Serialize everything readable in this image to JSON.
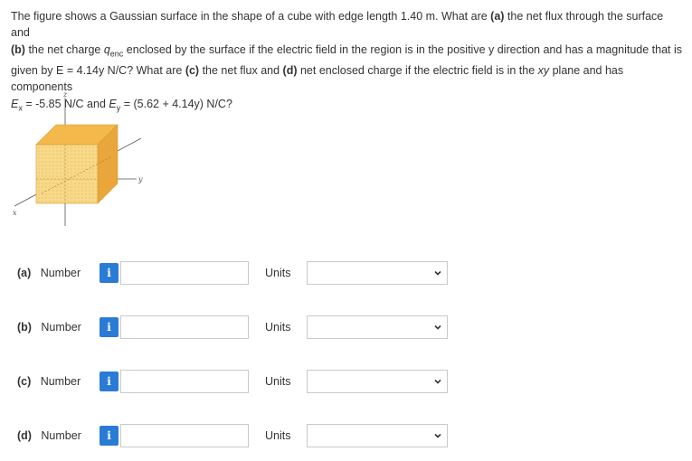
{
  "question": {
    "line1": "The figure shows a Gaussian surface in the shape of a cube with edge length 1.40 m. What are ",
    "part_a_tag": "(a)",
    "line1b": " the net flux through the surface and",
    "part_b_tag": "(b)",
    "line2a": " the net charge ",
    "q_sym": "q",
    "q_sub": "enc",
    "line2b": " enclosed by the surface if the electric field in the region is in the positive y direction and has a magnitude that is",
    "line3a": "given by E = 4.14y N/C? What are ",
    "part_c_tag": "(c)",
    "line3b": " the net flux and ",
    "part_d_tag": "(d)",
    "line3c": " net enclosed charge if the electric field is in the ",
    "xy": "xy",
    "line3d": " plane and has components",
    "ex_sym": "E",
    "ex_sub": "x",
    "ex_val": " = -5.85 N/C and ",
    "ey_sym": "E",
    "ey_sub": "y",
    "ey_val": " = (5.62 + 4.14y) N/C?"
  },
  "figure": {
    "axis_z": "z",
    "axis_y": "y",
    "axis_x": "x",
    "colors": {
      "cube_front": "#f7d77e",
      "cube_top": "#f3b94a",
      "cube_side": "#e9a63a",
      "axis": "#555555"
    }
  },
  "rows": [
    {
      "part": "(a)",
      "label": "Number",
      "units_label": "Units",
      "value": "",
      "units_value": ""
    },
    {
      "part": "(b)",
      "label": "Number",
      "units_label": "Units",
      "value": "",
      "units_value": ""
    },
    {
      "part": "(c)",
      "label": "Number",
      "units_label": "Units",
      "value": "",
      "units_value": ""
    },
    {
      "part": "(d)",
      "label": "Number",
      "units_label": "Units",
      "value": "",
      "units_value": ""
    }
  ],
  "info_glyph": "i",
  "accent_color": "#2a7bd6"
}
